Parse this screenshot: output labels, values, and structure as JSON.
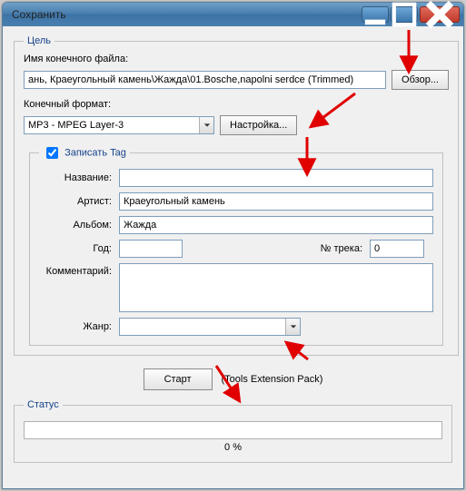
{
  "window": {
    "title": "Сохранить"
  },
  "target": {
    "legend": "Цель",
    "filename_label": "Имя конечного файла:",
    "filename_value": "ань, Краеугольный камень\\Жажда\\01.Bosche,napolni serdce (Trimmed)",
    "browse_label": "Обзор...",
    "format_label": "Конечный формат:",
    "format_value": "MP3 - MPEG Layer-3",
    "settings_label": "Настройка..."
  },
  "tag": {
    "legend": "Записать Tag",
    "checked": true,
    "title_label": "Название:",
    "title_value": "",
    "artist_label": "Артист:",
    "artist_value": "Краеугольный камень",
    "album_label": "Альбом:",
    "album_value": "Жажда",
    "year_label": "Год:",
    "year_value": "",
    "track_label": "№ трека:",
    "track_value": "0",
    "comment_label": "Комментарий:",
    "comment_value": "",
    "genre_label": "Жанр:",
    "genre_value": ""
  },
  "actions": {
    "start_label": "Старт",
    "ext_pack_label": "(Tools Extension Pack)"
  },
  "status": {
    "legend": "Статус",
    "percent": "0 %"
  }
}
